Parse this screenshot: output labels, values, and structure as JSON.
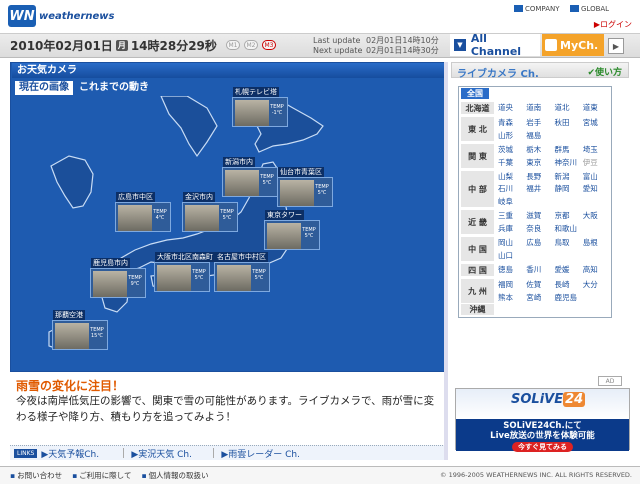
{
  "header": {
    "logo_mark": "WN",
    "logo_text": "weathernews",
    "company_label": "COMPANY",
    "global_label": "GLOBAL",
    "login_label": "ログイン"
  },
  "datebar": {
    "date": "2010年02月01日",
    "day": "月",
    "time": "14時28分29秒",
    "modes": [
      "M1",
      "M2",
      "M3"
    ],
    "last_update_label": "Last update",
    "last_update_value": "02月01日14時10分",
    "next_update_label": "Next update",
    "next_update_value": "02月01日14時30分",
    "all_channel": "All Channel",
    "my_ch": "MyCh.",
    "arrow": "▶"
  },
  "main": {
    "panel_title": "お天気カメラ",
    "tab_current": "現在の画像",
    "tab_history": "これまでの動き",
    "temp_label": "TEMP",
    "cameras": [
      {
        "name": "札幌テレビ塔",
        "temp": "-1℃"
      },
      {
        "name": "新潟市内",
        "temp": "5℃"
      },
      {
        "name": "仙台市青葉区",
        "temp": "5℃"
      },
      {
        "name": "広島市中区",
        "temp": "4℃"
      },
      {
        "name": "金沢市内",
        "temp": "5℃"
      },
      {
        "name": "東京タワー",
        "temp": "5℃"
      },
      {
        "name": "鹿児島市内",
        "temp": "9℃"
      },
      {
        "name": "大阪市北区南森町",
        "temp": "5℃"
      },
      {
        "name": "名古屋市中村区",
        "temp": "5℃"
      },
      {
        "name": "那覇空港",
        "temp": "15℃"
      }
    ],
    "headline": "雨雪の変化に注目！",
    "body": "今夜は南岸低気圧の影響で、関東で雪の可能性があります。ライブカメラで、雨が雪に変わる様子や降り方、積もり方を追ってみよう！",
    "links_tag": "LINKS",
    "links": [
      "天気予報Ch.",
      "実況天気 Ch.",
      "雨雲レーダー Ch."
    ]
  },
  "right": {
    "title": "ライブカメラ Ch.",
    "help": "使い方",
    "all_label": "全国",
    "regions": [
      {
        "name": "北海道",
        "cities": [
          "道央",
          "道南",
          "道北",
          "道東"
        ]
      },
      {
        "name": "東 北",
        "cities": [
          "青森",
          "岩手",
          "秋田",
          "宮城",
          "山形",
          "福島"
        ]
      },
      {
        "name": "関 東",
        "cities": [
          "茨城",
          "栃木",
          "群馬",
          "埼玉",
          "千葉",
          "東京",
          "神奈川",
          "伊豆"
        ]
      },
      {
        "name": "中 部",
        "cities": [
          "山梨",
          "長野",
          "新潟",
          "富山",
          "石川",
          "福井",
          "静岡",
          "愛知",
          "岐阜"
        ]
      },
      {
        "name": "近 畿",
        "cities": [
          "三重",
          "滋賀",
          "京都",
          "大阪",
          "兵庫",
          "奈良",
          "和歌山"
        ]
      },
      {
        "name": "中 国",
        "cities": [
          "岡山",
          "広島",
          "鳥取",
          "島根",
          "山口"
        ]
      },
      {
        "name": "四 国",
        "cities": [
          "徳島",
          "香川",
          "愛媛",
          "高知"
        ]
      },
      {
        "name": "九 州",
        "cities": [
          "福岡",
          "佐賀",
          "長崎",
          "大分",
          "熊本",
          "宮崎",
          "鹿児島"
        ]
      },
      {
        "name": "沖縄",
        "cities": []
      }
    ],
    "ad_icon": "AD",
    "ad_logo": "SOLiVE",
    "ad_logo_num": "24",
    "ad_line1": "SOLiVE24Ch.にて",
    "ad_line2": "Live放送の世界を体験可能",
    "ad_button": "今すぐ見てみる"
  },
  "footer": {
    "links": [
      "お問い合わせ",
      "ご利用に際して",
      "個人情報の取扱い"
    ],
    "copyright": "© 1996-2005 WEATHERNEWS INC. ALL RIGHTS RESERVED."
  },
  "colors": {
    "brand": "#1a4f9e",
    "accent": "#f4a32a",
    "headline": "#e05a00",
    "map_sea": "#1e5bb0"
  }
}
